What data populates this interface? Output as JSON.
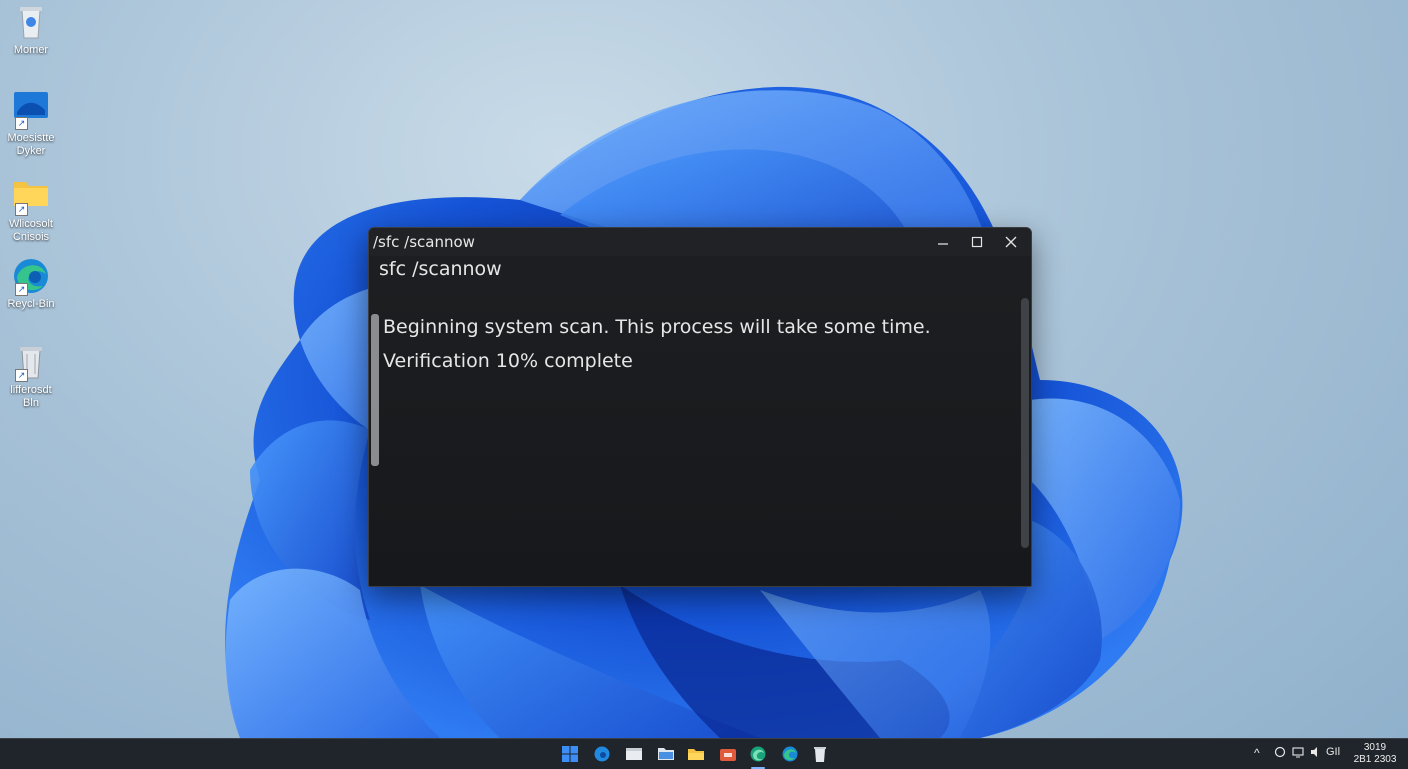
{
  "desktop": {
    "icons": [
      {
        "label": "Momer",
        "icon": "recycle-bin-icon"
      },
      {
        "label": "Moesistte Dyker",
        "icon": "windows-monitor-icon"
      },
      {
        "label": "Wlicosolt Cnisois",
        "icon": "folder-icon"
      },
      {
        "label": "Reycl-Bin",
        "icon": "edge-icon"
      },
      {
        "label": "lifferosdt Bln",
        "icon": "recycle-bin-icon"
      }
    ]
  },
  "terminal": {
    "title": "/sfc /scannow",
    "command_line": "sfc /scannow",
    "output": [
      "Beginning system scan. This process will take some time.",
      "Verification 10% complete"
    ],
    "controls": {
      "minimize": "minimize-icon",
      "maximize": "maximize-icon",
      "close": "close-icon"
    }
  },
  "taskbar": {
    "apps": [
      "start-icon",
      "edge-icon",
      "file-explorer-icon",
      "folder-icon",
      "file-manager-icon",
      "store-icon",
      "edge-beta-icon",
      "edge-icon",
      "recycle-bin-icon"
    ],
    "tray": {
      "chevron": "^",
      "items": [
        "chat-icon",
        "display-icon",
        "volume-icon"
      ],
      "lang": "GIl"
    },
    "clock": {
      "time": "3019",
      "date": "2B1 2303"
    }
  },
  "colors": {
    "accent": "#1a6cf0",
    "taskbar": "#20252c",
    "terminal_bg": "#1a1c1f"
  }
}
